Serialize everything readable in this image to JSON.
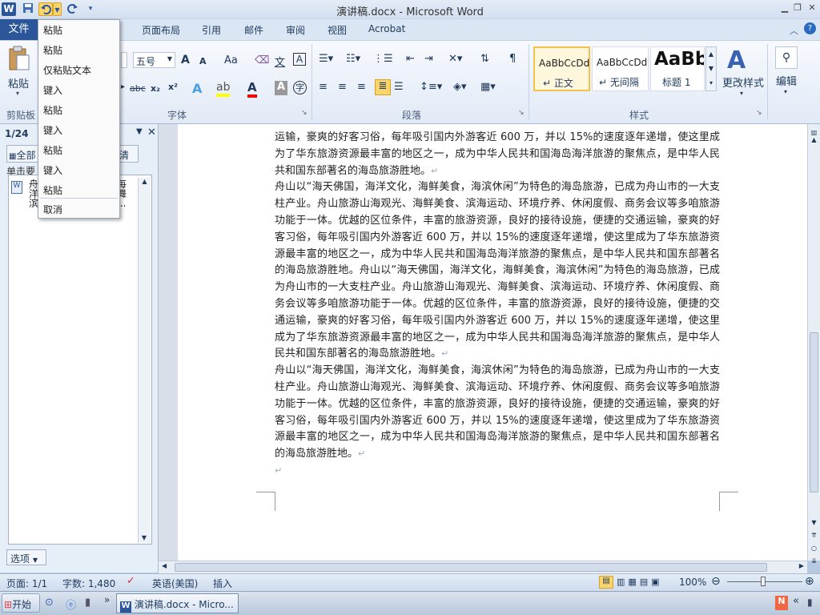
{
  "window": {
    "title": "演讲稿.docx - Microsoft Word",
    "app_icon": "W"
  },
  "quick_access": {
    "items": [
      "word-app-icon",
      "save-icon",
      "undo-icon",
      "dropdown-arrow-icon",
      "redo-icon",
      "customize-icon"
    ]
  },
  "tabs": {
    "file": "文件",
    "items": [
      "页面布局",
      "引用",
      "邮件",
      "审阅",
      "视图",
      "Acrobat"
    ]
  },
  "ribbon": {
    "clipboard": {
      "paste": "粘贴",
      "label": "剪贴板"
    },
    "font": {
      "size": "五号",
      "grow": "A",
      "shrink": "A",
      "case": "Aa",
      "label": "字体"
    },
    "paragraph": {
      "label": "段落"
    },
    "styles": {
      "label": "样式",
      "items": [
        {
          "preview": "AaBbCcDd",
          "name": "↵ 正文"
        },
        {
          "preview": "AaBbCcDd",
          "name": "↵ 无间隔"
        },
        {
          "preview": "AaBb",
          "name": "标题 1"
        }
      ],
      "change": "更改样式"
    },
    "editing": {
      "label": "编辑"
    }
  },
  "context_menu": {
    "items": [
      "粘贴",
      "粘贴",
      "仅粘贴文本",
      "键入",
      "粘贴",
      "键入",
      "粘贴",
      "键入",
      "粘贴",
      "取消"
    ]
  },
  "nav_pane": {
    "page": "1/24",
    "search_all": "全部",
    "clear": "清空",
    "hint": "单击要",
    "result": {
      "l1": "舟山",
      "l2": "洋文",
      "l3": "滨运",
      "r1": "每",
      "r2": "舞",
      "r3": "..."
    },
    "options": "选项"
  },
  "document": {
    "paragraphs": [
      "运输，豪爽的好客习俗，每年吸引国内外游客近 600 万，并以 15%的速度逐年递增，使这里成为了华东旅游资源最丰富的地区之一，成为中华人民共和国海岛海洋旅游的聚焦点，是中华人民共和国东部著名的海岛旅游胜地。",
      "舟山以“海天佛国，海洋文化，海鲜美食，海滨休闲”为特色的海岛旅游，已成为舟山市的一大支柱产业。舟山旅游山海观光、海鲜美食、滨海运动、环境疗养、休闲度假、商务会议等多咱旅游功能于一体。优越的区位条件，丰富的旅游资源，良好的接待设施，便捷的交通运输，豪爽的好客习俗，每年吸引国内外游客近 600 万，并以 15%的速度逐年递增，使这里成为了华东旅游资源最丰富的地区之一，成为中华人民共和国海岛海洋旅游的聚焦点，是中华人民共和国东部著名的海岛旅游胜地。舟山以“海天佛国，海洋文化，海鲜美食，海滨休闲”为特色的海岛旅游，已成为舟山市的一大支柱产业。舟山旅游山海观光、海鲜美食、滨海运动、环境疗养、休闲度假、商务会议等多咱旅游功能于一体。优越的区位条件，丰富的旅游资源，良好的接待设施，便捷的交通运输，豪爽的好客习俗，每年吸引国内外游客近 600 万，并以 15%的速度逐年递增，使这里成为了华东旅游资源最丰富的地区之一，成为中华人民共和国海岛海洋旅游的聚焦点，是中华人民共和国东部著名的海岛旅游胜地。",
      "舟山以“海天佛国，海洋文化，海鲜美食，海滨休闲”为特色的海岛旅游，已成为舟山市的一大支柱产业。舟山旅游山海观光、海鲜美食、滨海运动、环境疗养、休闲度假、商务会议等多咱旅游功能于一体。优越的区位条件，丰富的旅游资源，良好的接待设施，便捷的交通运输，豪爽的好客习俗，每年吸引国内外游客近 600 万，并以 15%的速度逐年递增，使这里成为了华东旅游资源最丰富的地区之一，成为中华人民共和国海岛海洋旅游的聚焦点，是中华人民共和国东部著名的海岛旅游胜地。"
    ],
    "paragraph_mark": "↵"
  },
  "status_bar": {
    "page": "页面: 1/1",
    "words": "字数: 1,480",
    "language": "英语(美国)",
    "mode": "插入",
    "zoom": "100%"
  },
  "taskbar": {
    "start": "开始",
    "task": "演讲稿.docx - Micro...",
    "tray": "«"
  }
}
